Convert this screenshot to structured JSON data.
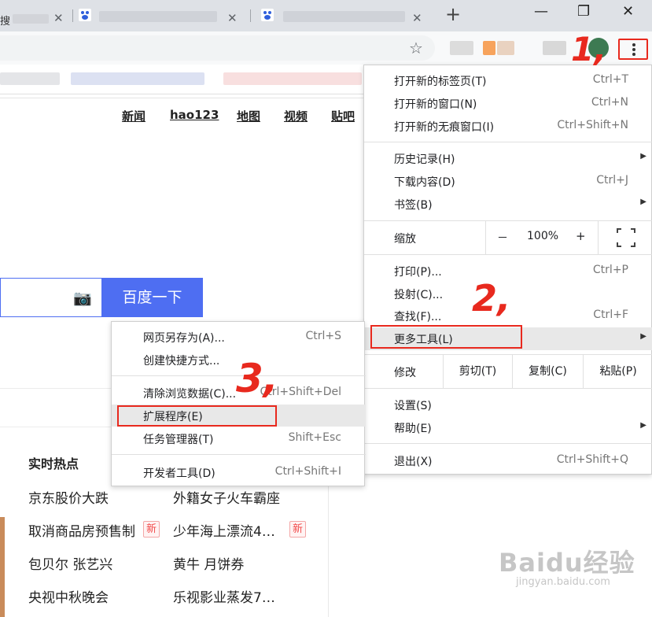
{
  "tabs": {
    "first_partial": "搜",
    "close_glyph": "✕",
    "new_tab_glyph": "+"
  },
  "window": {
    "minimize": "—",
    "restore": "❐",
    "close": "✕"
  },
  "toolbar": {
    "star_icon": "star-icon",
    "menu_icon": "more-vert-icon"
  },
  "bookmarks": {
    "partial": ""
  },
  "page": {
    "nav": [
      "新闻",
      "hao123",
      "地图",
      "视频",
      "贴吧"
    ],
    "search_button": "百度一下",
    "hot_title": "实时热点",
    "hot_items": [
      {
        "text": "京东股价大跌",
        "new": false
      },
      {
        "text": "外籍女子火车霸座",
        "new": false
      },
      {
        "text": "取消商品房预售制",
        "new": true
      },
      {
        "text": "少年海上漂流4…",
        "new": true
      },
      {
        "text": "包贝尔 张艺兴",
        "new": false
      },
      {
        "text": "黄牛 月饼券",
        "new": false
      },
      {
        "text": "央视中秋晚会",
        "new": false
      },
      {
        "text": "乐视影业蒸发7…",
        "new": false
      }
    ],
    "new_badge": "新"
  },
  "main_menu": {
    "group1": [
      {
        "label": "打开新的标签页(T)",
        "shortcut": "Ctrl+T"
      },
      {
        "label": "打开新的窗口(N)",
        "shortcut": "Ctrl+N"
      },
      {
        "label": "打开新的无痕窗口(I)",
        "shortcut": "Ctrl+Shift+N"
      }
    ],
    "group2": [
      {
        "label": "历史记录(H)",
        "submenu": true
      },
      {
        "label": "下载内容(D)",
        "shortcut": "Ctrl+J"
      },
      {
        "label": "书签(B)",
        "submenu": true
      }
    ],
    "zoom": {
      "label": "缩放",
      "minus": "－",
      "value": "100%",
      "plus": "+",
      "fullscreen_icon": "fullscreen-icon"
    },
    "group3": [
      {
        "label": "打印(P)...",
        "shortcut": "Ctrl+P"
      },
      {
        "label": "投射(C)...",
        "shortcut": ""
      },
      {
        "label": "查找(F)...",
        "shortcut": "Ctrl+F"
      },
      {
        "label": "更多工具(L)",
        "submenu": true,
        "highlighted": true
      }
    ],
    "edit": {
      "label": "修改",
      "cut": "剪切(T)",
      "copy": "复制(C)",
      "paste": "粘贴(P)"
    },
    "group4": [
      {
        "label": "设置(S)"
      },
      {
        "label": "帮助(E)",
        "submenu": true
      }
    ],
    "exit": {
      "label": "退出(X)",
      "shortcut": "Ctrl+Shift+Q"
    },
    "arrow_glyph": "▶"
  },
  "sub_menu": {
    "items": [
      {
        "label": "网页另存为(A)...",
        "shortcut": "Ctrl+S"
      },
      {
        "label": "创建快捷方式...",
        "shortcut": ""
      },
      {
        "label": "清除浏览数据(C)...",
        "shortcut": "Ctrl+Shift+Del"
      },
      {
        "label": "扩展程序(E)",
        "shortcut": "",
        "highlighted": true
      },
      {
        "label": "任务管理器(T)",
        "shortcut": "Shift+Esc"
      },
      {
        "label": "开发者工具(D)",
        "shortcut": "Ctrl+Shift+I"
      }
    ]
  },
  "annotations": {
    "step1": "1,",
    "step2": "2,",
    "step3": "3,"
  },
  "watermark": {
    "text": "Baidu经验",
    "url": "jingyan.baidu.com"
  },
  "colors": {
    "accent": "#4e6ef2",
    "annotation_red": "#e8291e",
    "menu_hover": "#e8e8e8"
  }
}
